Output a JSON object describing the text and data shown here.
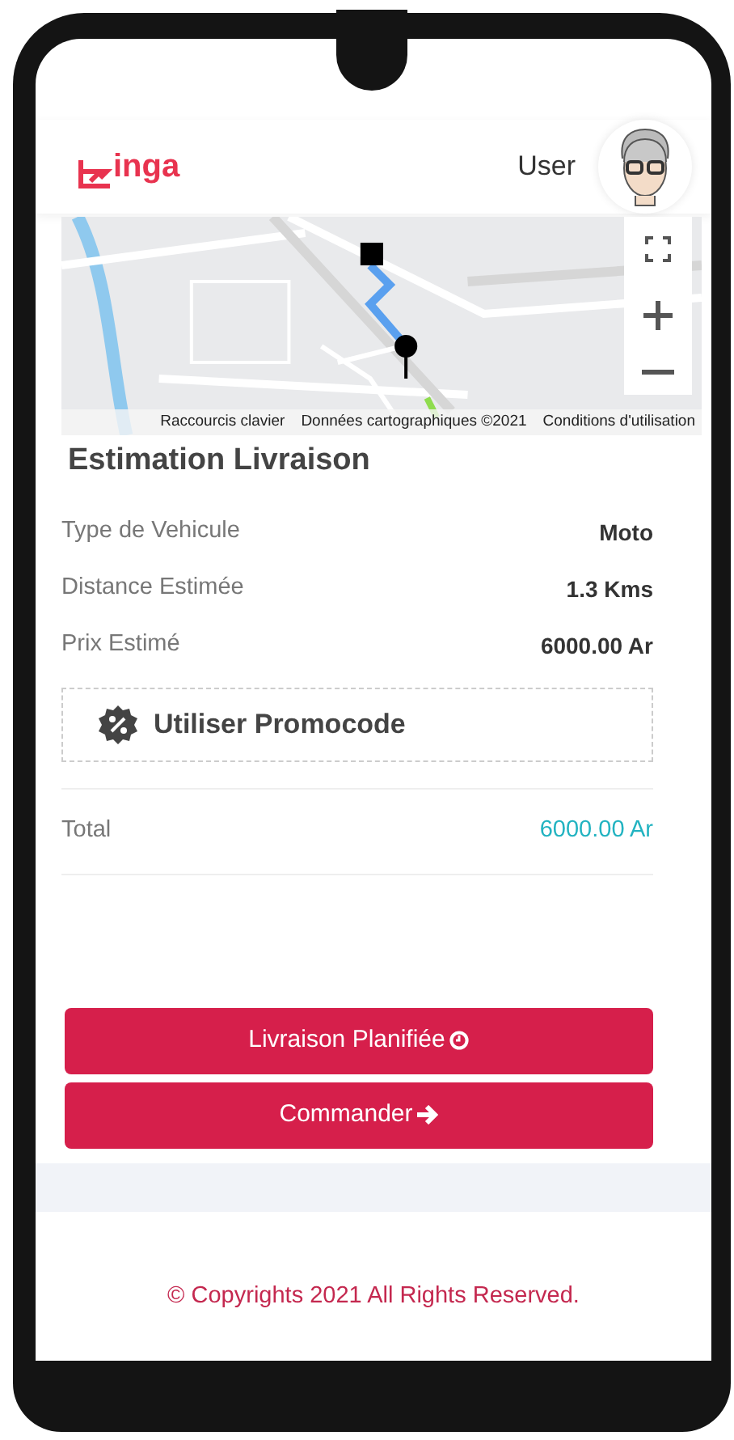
{
  "header": {
    "logo_text": "inga",
    "user_label": "User"
  },
  "map": {
    "kind": "picture",
    "attribution": [
      "Raccourcis clavier",
      "Données cartographiques ©2021",
      "Conditions d'utilisation"
    ]
  },
  "estimate": {
    "title": "Estimation Livraison",
    "rows": [
      {
        "label": "Type de Vehicule",
        "value": "Moto"
      },
      {
        "label": "Distance Estimée",
        "value": "1.3 Kms"
      },
      {
        "label": "Prix Estimé",
        "value": "6000.00 Ar"
      }
    ],
    "promo": "Utiliser Promocode",
    "total": {
      "label": "Total",
      "value": "6000.00 Ar"
    }
  },
  "buttons": [
    {
      "label": "Livraison Planifiée",
      "kind": "schedule"
    },
    {
      "label": "Commander",
      "kind": "order"
    }
  ],
  "footer": "© Copyrights 2021 All Rights Reserved."
}
